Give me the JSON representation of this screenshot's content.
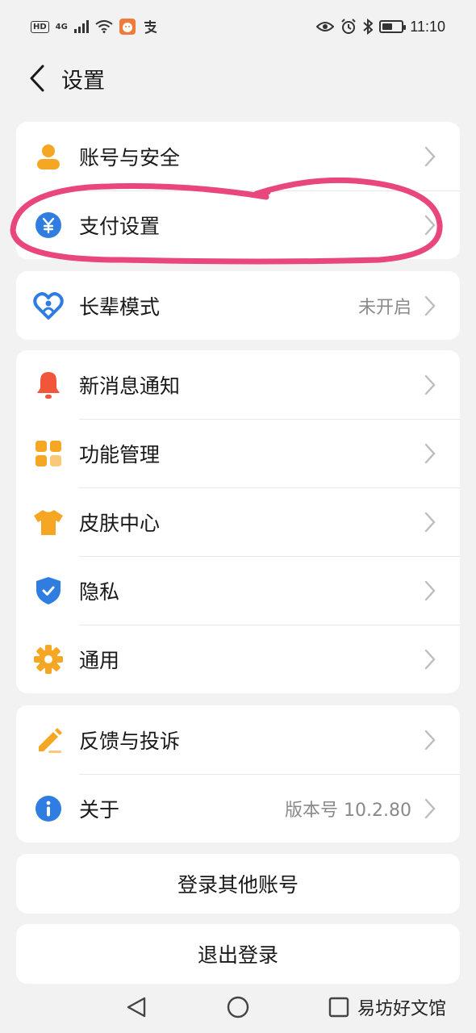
{
  "status_bar": {
    "hd": "HD",
    "network": "4G",
    "time": "11:10",
    "battery_level": 0.55
  },
  "header": {
    "title": "设置",
    "back_icon": "chevron-left-icon"
  },
  "groups": [
    {
      "items": [
        {
          "label": "账号与安全",
          "icon": "user-icon",
          "value": ""
        },
        {
          "label": "支付设置",
          "icon": "yuan-icon",
          "value": ""
        }
      ]
    },
    {
      "items": [
        {
          "label": "长辈模式",
          "icon": "heart-person-icon",
          "value": "未开启"
        }
      ]
    },
    {
      "items": [
        {
          "label": "新消息通知",
          "icon": "bell-icon",
          "value": ""
        },
        {
          "label": "功能管理",
          "icon": "grid-icon",
          "value": ""
        },
        {
          "label": "皮肤中心",
          "icon": "tshirt-icon",
          "value": ""
        },
        {
          "label": "隐私",
          "icon": "shield-icon",
          "value": ""
        },
        {
          "label": "通用",
          "icon": "gear-icon",
          "value": ""
        }
      ]
    },
    {
      "items": [
        {
          "label": "反馈与投诉",
          "icon": "pencil-icon",
          "value": ""
        },
        {
          "label": "关于",
          "icon": "info-icon",
          "value": "版本号 10.2.80"
        }
      ]
    }
  ],
  "buttons": {
    "switch_account": "登录其他账号",
    "logout": "退出登录"
  },
  "watermark": "易坊好文馆",
  "colors": {
    "orange": "#f5a623",
    "blue": "#2f7de1",
    "red": "#f2553a",
    "annotation": "#e8467c"
  }
}
